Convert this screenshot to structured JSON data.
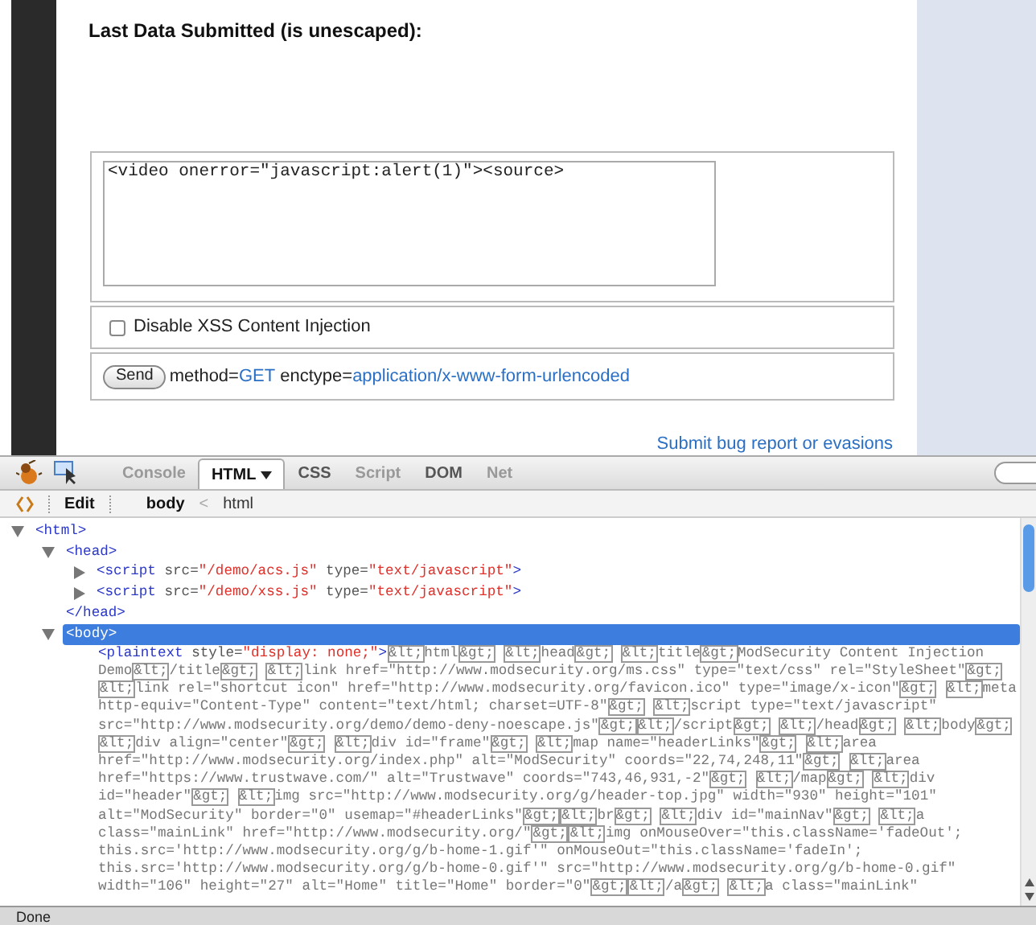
{
  "page": {
    "heading": "Last Data Submitted (is unescaped):",
    "form": {
      "textarea_value": "<video onerror=\"javascript:alert(1)\"><source>",
      "checkbox": {
        "label": "Disable XSS Content Injection",
        "checked": false
      },
      "send_button": "Send",
      "method_label": "method=",
      "method_value": "GET",
      "enctype_label": "enctype=",
      "enctype_value": "application/x-www-form-urlencoded"
    },
    "footer_link": "Submit bug report or evasions"
  },
  "devtools": {
    "tabs": [
      {
        "label": "Console",
        "selected": false,
        "disabled": true
      },
      {
        "label": "HTML",
        "selected": true,
        "disabled": false
      },
      {
        "label": "CSS",
        "selected": false,
        "disabled": false
      },
      {
        "label": "Script",
        "selected": false,
        "disabled": true
      },
      {
        "label": "DOM",
        "selected": false,
        "disabled": false
      },
      {
        "label": "Net",
        "selected": false,
        "disabled": true
      }
    ],
    "edit_button": "Edit",
    "breadcrumbs": [
      {
        "label": "body",
        "selected": true
      },
      {
        "label": "html",
        "selected": false
      }
    ],
    "breadcrumb_separator": "<",
    "tree": [
      {
        "kind": "node",
        "label": [
          {
            "kind": "tag",
            "text": "<html>"
          }
        ],
        "expanded": true,
        "selected": false,
        "children": [
          {
            "kind": "node",
            "label": [
              {
                "kind": "tag",
                "text": "<head>"
              }
            ],
            "expanded": true,
            "selected": false,
            "children": [
              {
                "kind": "node",
                "label": [
                  {
                    "kind": "tag",
                    "text": "<script"
                  },
                  {
                    "kind": "attr",
                    "text": " src="
                  },
                  {
                    "kind": "value",
                    "text": "\"/demo/acs.js\""
                  },
                  {
                    "kind": "attr",
                    "text": " type="
                  },
                  {
                    "kind": "value",
                    "text": "\"text/javascript\""
                  },
                  {
                    "kind": "tag",
                    "text": ">"
                  }
                ],
                "expanded": false,
                "selected": false
              },
              {
                "kind": "node",
                "label": [
                  {
                    "kind": "tag",
                    "text": "<script"
                  },
                  {
                    "kind": "attr",
                    "text": " src="
                  },
                  {
                    "kind": "value",
                    "text": "\"/demo/xss.js\""
                  },
                  {
                    "kind": "attr",
                    "text": " type="
                  },
                  {
                    "kind": "value",
                    "text": "\"text/javascript\""
                  },
                  {
                    "kind": "tag",
                    "text": ">"
                  }
                ],
                "expanded": false,
                "selected": false
              }
            ]
          },
          {
            "kind": "close",
            "label": [
              {
                "kind": "tag",
                "text": "</head>"
              }
            ]
          },
          {
            "kind": "node",
            "label": [
              {
                "kind": "tag",
                "text": "<body>"
              }
            ],
            "expanded": true,
            "selected": true,
            "children": [
              {
                "kind": "content",
                "lines": [
                  [
                    {
                      "kind": "tag",
                      "text": "<plaintext"
                    },
                    {
                      "kind": "attr",
                      "text": " style="
                    },
                    {
                      "kind": "value",
                      "text": "\"display: none;\""
                    },
                    {
                      "kind": "tag",
                      "text": ">"
                    },
                    {
                      "kind": "entity",
                      "text": "&lt;"
                    },
                    {
                      "kind": "text",
                      "text": "html"
                    },
                    {
                      "kind": "entity",
                      "text": "&gt;",
                      "space_after": true
                    },
                    {
                      "kind": "entity",
                      "text": "&lt;"
                    },
                    {
                      "kind": "text",
                      "text": "head"
                    },
                    {
                      "kind": "entity",
                      "text": "&gt;",
                      "space_after": true
                    },
                    {
                      "kind": "entity",
                      "text": "&lt;"
                    },
                    {
                      "kind": "text",
                      "text": "title"
                    },
                    {
                      "kind": "entity",
                      "text": "&gt;"
                    },
                    {
                      "kind": "text",
                      "text": "ModSecurity Content Injection"
                    }
                  ],
                  [
                    {
                      "kind": "text",
                      "text": "Demo"
                    },
                    {
                      "kind": "entity",
                      "text": "&lt;"
                    },
                    {
                      "kind": "text",
                      "text": "/title"
                    },
                    {
                      "kind": "entity",
                      "text": "&gt;",
                      "space_after": true
                    },
                    {
                      "kind": "entity",
                      "text": "&lt;"
                    },
                    {
                      "kind": "text",
                      "text": "link href=\"http://www.modsecurity.org/ms.css\" type=\"text/css\" rel=\"StyleSheet\""
                    },
                    {
                      "kind": "entity",
                      "text": "&gt;"
                    }
                  ],
                  [
                    {
                      "kind": "entity",
                      "text": "&lt;"
                    },
                    {
                      "kind": "text",
                      "text": "link rel=\"shortcut icon\" href=\"http://www.modsecurity.org/favicon.ico\" type=\"image/x-icon\""
                    },
                    {
                      "kind": "entity",
                      "text": "&gt;",
                      "space_after": true
                    },
                    {
                      "kind": "entity",
                      "text": "&lt;"
                    },
                    {
                      "kind": "text",
                      "text": "meta"
                    }
                  ],
                  [
                    {
                      "kind": "text",
                      "text": "http-equiv=\"Content-Type\" content=\"text/html; charset=UTF-8\""
                    },
                    {
                      "kind": "entity",
                      "text": "&gt;",
                      "space_after": true
                    },
                    {
                      "kind": "entity",
                      "text": "&lt;"
                    },
                    {
                      "kind": "text",
                      "text": "script type=\"text/javascript\""
                    }
                  ],
                  [
                    {
                      "kind": "text",
                      "text": "src=\"http://www.modsecurity.org/demo/demo-deny-noescape.js\""
                    },
                    {
                      "kind": "entity",
                      "text": "&gt;"
                    },
                    {
                      "kind": "entity",
                      "text": "&lt;"
                    },
                    {
                      "kind": "text",
                      "text": "/script"
                    },
                    {
                      "kind": "entity",
                      "text": "&gt;",
                      "space_after": true
                    },
                    {
                      "kind": "entity",
                      "text": "&lt;"
                    },
                    {
                      "kind": "text",
                      "text": "/head"
                    },
                    {
                      "kind": "entity",
                      "text": "&gt;",
                      "space_after": true
                    },
                    {
                      "kind": "entity",
                      "text": "&lt;"
                    },
                    {
                      "kind": "text",
                      "text": "body"
                    },
                    {
                      "kind": "entity",
                      "text": "&gt;"
                    }
                  ],
                  [
                    {
                      "kind": "entity",
                      "text": "&lt;"
                    },
                    {
                      "kind": "text",
                      "text": "div align=\"center\""
                    },
                    {
                      "kind": "entity",
                      "text": "&gt;",
                      "space_after": true
                    },
                    {
                      "kind": "entity",
                      "text": "&lt;"
                    },
                    {
                      "kind": "text",
                      "text": "div id=\"frame\""
                    },
                    {
                      "kind": "entity",
                      "text": "&gt;",
                      "space_after": true
                    },
                    {
                      "kind": "entity",
                      "text": "&lt;"
                    },
                    {
                      "kind": "text",
                      "text": "map name=\"headerLinks\""
                    },
                    {
                      "kind": "entity",
                      "text": "&gt;",
                      "space_after": true
                    },
                    {
                      "kind": "entity",
                      "text": "&lt;"
                    },
                    {
                      "kind": "text",
                      "text": "area"
                    }
                  ],
                  [
                    {
                      "kind": "text",
                      "text": "href=\"http://www.modsecurity.org/index.php\" alt=\"ModSecurity\" coords=\"22,74,248,11\""
                    },
                    {
                      "kind": "entity",
                      "text": "&gt;",
                      "space_after": true
                    },
                    {
                      "kind": "entity",
                      "text": "&lt;"
                    },
                    {
                      "kind": "text",
                      "text": "area"
                    }
                  ],
                  [
                    {
                      "kind": "text",
                      "text": "href=\"https://www.trustwave.com/\" alt=\"Trustwave\" coords=\"743,46,931,-2\""
                    },
                    {
                      "kind": "entity",
                      "text": "&gt;",
                      "space_after": true
                    },
                    {
                      "kind": "entity",
                      "text": "&lt;"
                    },
                    {
                      "kind": "text",
                      "text": "/map"
                    },
                    {
                      "kind": "entity",
                      "text": "&gt;",
                      "space_after": true
                    },
                    {
                      "kind": "entity",
                      "text": "&lt;"
                    },
                    {
                      "kind": "text",
                      "text": "div"
                    }
                  ],
                  [
                    {
                      "kind": "text",
                      "text": "id=\"header\""
                    },
                    {
                      "kind": "entity",
                      "text": "&gt;",
                      "space_after": true
                    },
                    {
                      "kind": "entity",
                      "text": "&lt;"
                    },
                    {
                      "kind": "text",
                      "text": "img src=\"http://www.modsecurity.org/g/header-top.jpg\" width=\"930\" height=\"101\""
                    }
                  ],
                  [
                    {
                      "kind": "text",
                      "text": "alt=\"ModSecurity\" border=\"0\" usemap=\"#headerLinks\""
                    },
                    {
                      "kind": "entity",
                      "text": "&gt;"
                    },
                    {
                      "kind": "entity",
                      "text": "&lt;"
                    },
                    {
                      "kind": "text",
                      "text": "br"
                    },
                    {
                      "kind": "entity",
                      "text": "&gt;",
                      "space_after": true
                    },
                    {
                      "kind": "entity",
                      "text": "&lt;"
                    },
                    {
                      "kind": "text",
                      "text": "div id=\"mainNav\""
                    },
                    {
                      "kind": "entity",
                      "text": "&gt;",
                      "space_after": true
                    },
                    {
                      "kind": "entity",
                      "text": "&lt;"
                    },
                    {
                      "kind": "text",
                      "text": "a"
                    }
                  ],
                  [
                    {
                      "kind": "text",
                      "text": "class=\"mainLink\" href=\"http://www.modsecurity.org/\""
                    },
                    {
                      "kind": "entity",
                      "text": "&gt;"
                    },
                    {
                      "kind": "entity",
                      "text": "&lt;"
                    },
                    {
                      "kind": "text",
                      "text": "img onMouseOver=\"this.className='fadeOut';"
                    }
                  ],
                  [
                    {
                      "kind": "text",
                      "text": "this.src='http://www.modsecurity.org/g/b-home-1.gif'\" onMouseOut=\"this.className='fadeIn';"
                    }
                  ],
                  [
                    {
                      "kind": "text",
                      "text": "this.src='http://www.modsecurity.org/g/b-home-0.gif'\" src=\"http://www.modsecurity.org/g/b-home-0.gif\""
                    }
                  ],
                  [
                    {
                      "kind": "text",
                      "text": "width=\"106\" height=\"27\" alt=\"Home\" title=\"Home\" border=\"0\""
                    },
                    {
                      "kind": "entity",
                      "text": "&gt;"
                    },
                    {
                      "kind": "entity",
                      "text": "&lt;"
                    },
                    {
                      "kind": "text",
                      "text": "/a"
                    },
                    {
                      "kind": "entity",
                      "text": "&gt;",
                      "space_after": true
                    },
                    {
                      "kind": "entity",
                      "text": "&lt;"
                    },
                    {
                      "kind": "text",
                      "text": "a class=\"mainLink\""
                    }
                  ]
                ]
              }
            ]
          }
        ]
      }
    ]
  },
  "status_bar": "Done"
}
